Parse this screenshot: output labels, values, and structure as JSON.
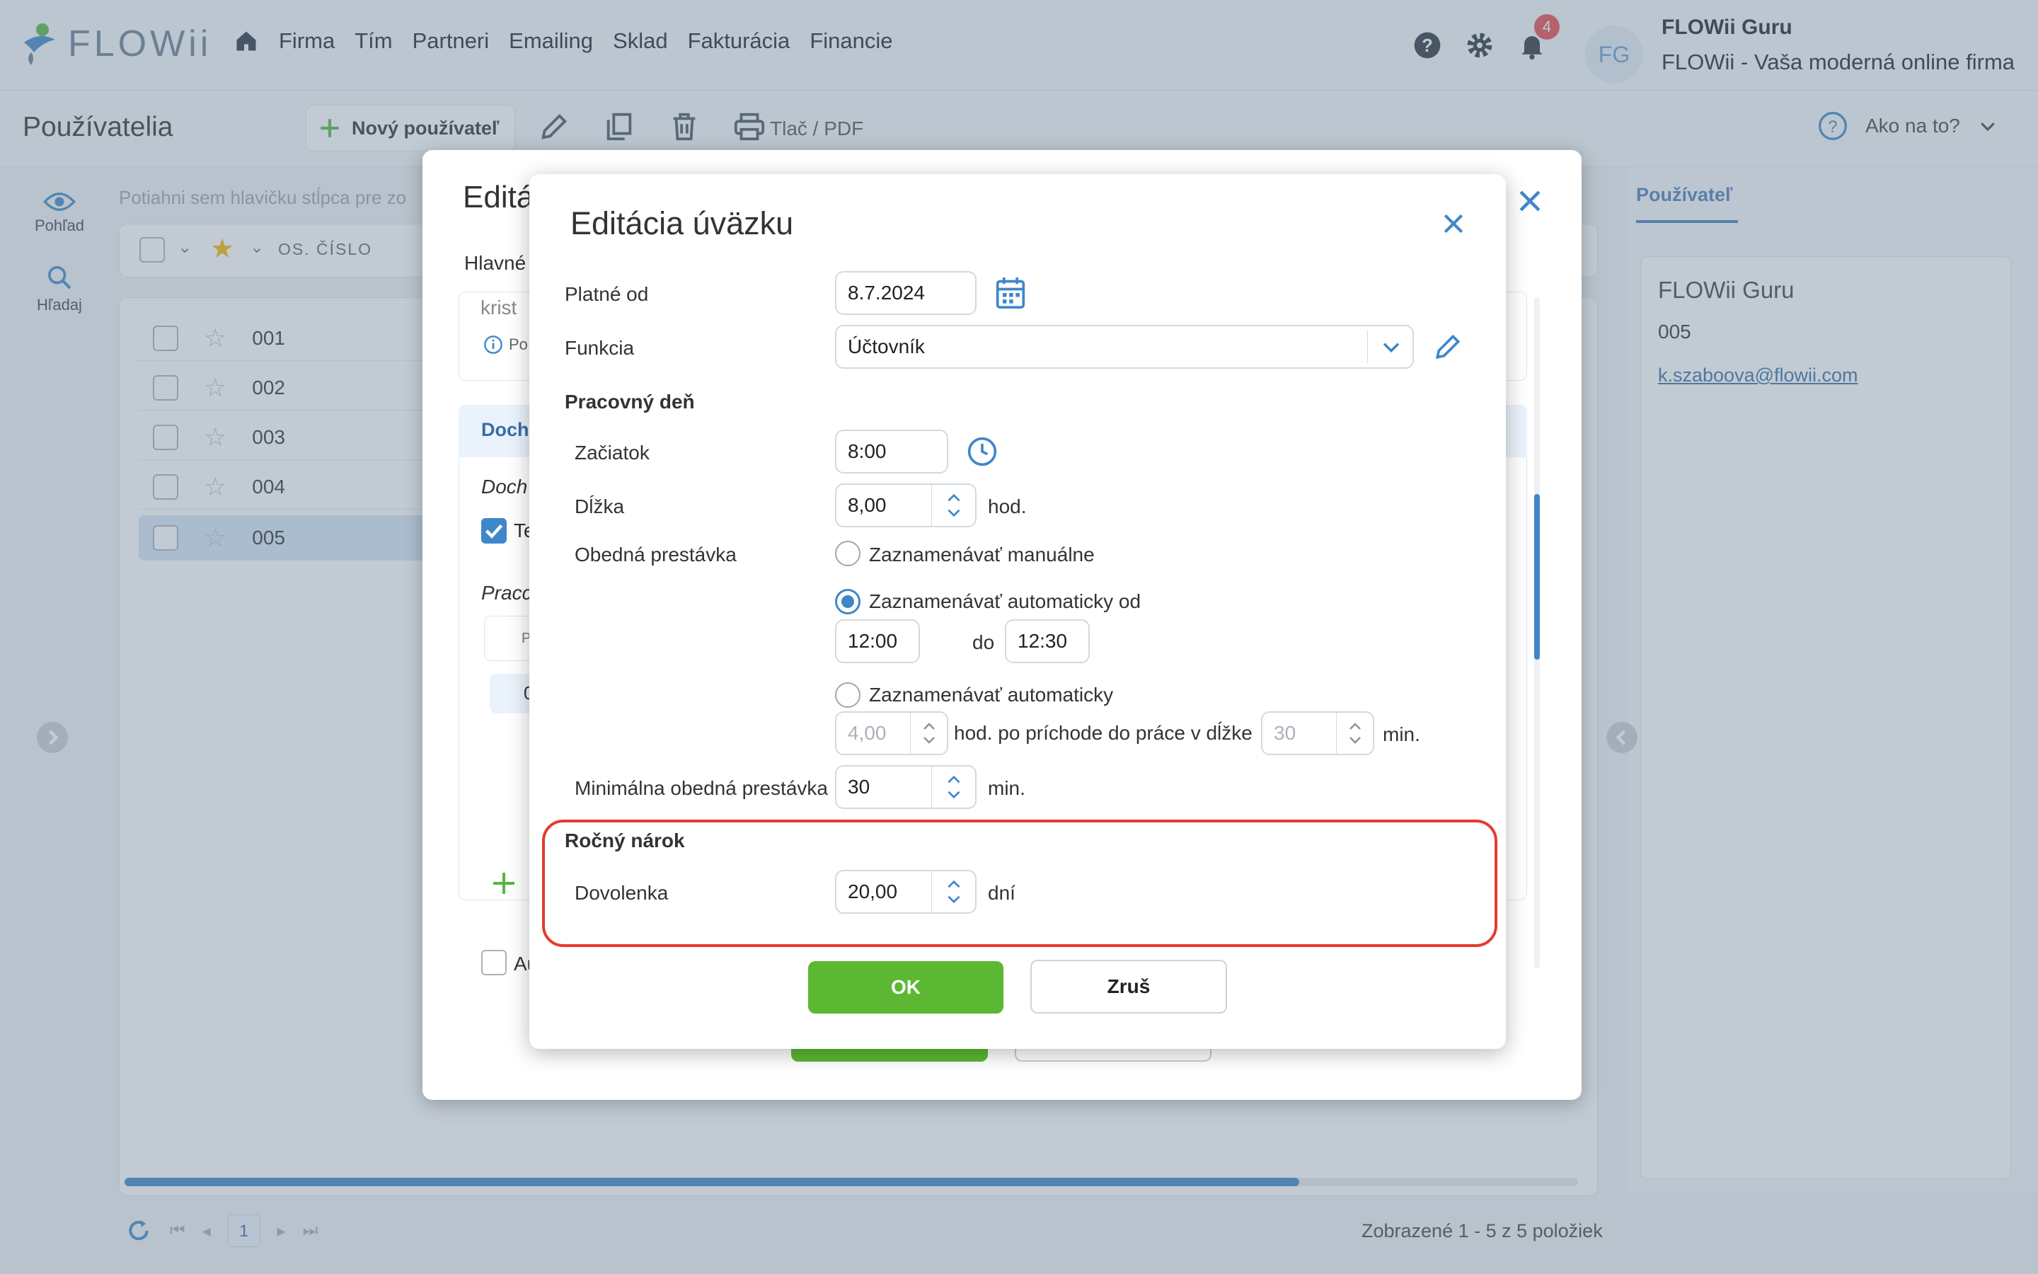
{
  "app": {
    "brand": "FLOWii"
  },
  "nav": {
    "items": [
      "Firma",
      "Tím",
      "Partneri",
      "Emailing",
      "Sklad",
      "Fakturácia",
      "Financie"
    ]
  },
  "top_right": {
    "notification_count": "4",
    "avatar_initials": "FG",
    "user_name": "FLOWii Guru",
    "firm_name": "FLOWii - Vaša moderná online firma"
  },
  "toolbar": {
    "page_title": "Používatelia",
    "new_user": "Nový používateľ",
    "print": "Tlač / PDF",
    "help": "Ako na to?"
  },
  "rail": {
    "view": "Pohľad",
    "search": "Hľadaj"
  },
  "grid": {
    "drag_hint": "Potiahni sem hlavičku stĺpca pre zo",
    "column": "OS. ČÍSLO",
    "rows": [
      "001",
      "002",
      "003",
      "004",
      "005"
    ],
    "selected_index": 4,
    "pager_page": "1",
    "shown": "Zobrazené 1 - 5 z 5 položiek"
  },
  "right_panel": {
    "tab": "Používateľ",
    "name": "FLOWii Guru",
    "number": "005",
    "email": "k.szaboova@flowii.com"
  },
  "outer_dialog": {
    "title": "Editá",
    "tab": "Hlavné",
    "input_fragment": "krist",
    "info_fragment": "Po",
    "section_fragment": "Doch",
    "italic1": "Doch",
    "check_fragment": "Te",
    "italic2": "Pracc",
    "col_fragment": "P",
    "cell_fragment": "0",
    "bottom_fragment": "Au"
  },
  "dialog": {
    "title": "Editácia úväzku",
    "valid_from_label": "Platné od",
    "valid_from": "8.7.2024",
    "function_label": "Funkcia",
    "function_value": "Účtovník",
    "workday_heading": "Pracovný deň",
    "start_label": "Začiatok",
    "start_value": "8:00",
    "length_label": "Dĺžka",
    "length_value": "8,00",
    "hours_unit": "hod.",
    "lunch_label": "Obedná prestávka",
    "opt_manual": "Zaznamenávať manuálne",
    "opt_auto_from": "Zaznamenávať automaticky od",
    "from_value": "12:00",
    "to_label": "do",
    "to_value": "12:30",
    "opt_auto": "Zaznamenávať automaticky",
    "auto_hours": "4,00",
    "auto_text": "hod. po príchode do práce v dĺžke",
    "auto_minutes": "30",
    "min_unit": "min.",
    "min_lunch_label": "Minimálna obedná prestávka",
    "min_lunch_value": "30",
    "annual_heading": "Ročný nárok",
    "vacation_label": "Dovolenka",
    "vacation_value": "20,00",
    "days_unit": "dní",
    "ok": "OK",
    "cancel": "Zruš"
  },
  "colors": {
    "accent": "#3f87c9",
    "ok_green": "#5cb832",
    "highlight_red": "#e63b2e"
  }
}
